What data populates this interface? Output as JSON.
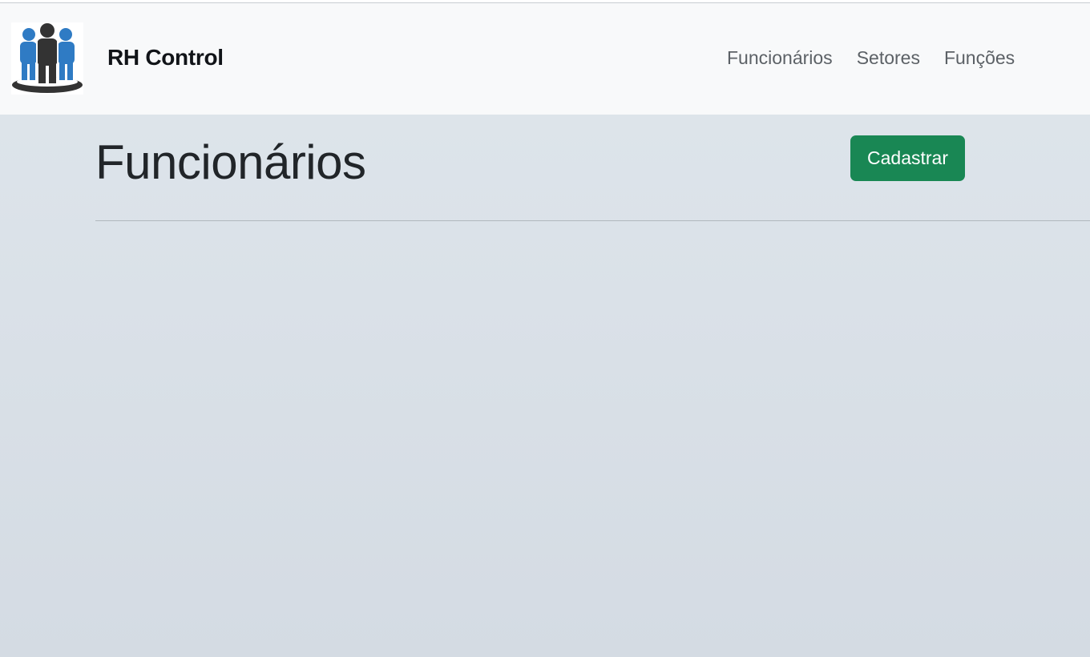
{
  "brand": {
    "name": "RH Control",
    "logo_icon": "people-group-icon"
  },
  "nav": {
    "items": [
      {
        "label": "Funcionários"
      },
      {
        "label": "Setores"
      },
      {
        "label": "Funções"
      }
    ]
  },
  "main": {
    "title": "Funcionários",
    "create_button_label": "Cadastrar"
  },
  "colors": {
    "navbar_bg": "#f8f9fa",
    "page_bg": "#dfe6ec",
    "button_success": "#198754",
    "logo_blue": "#2f7bc4",
    "logo_dark": "#333333"
  }
}
